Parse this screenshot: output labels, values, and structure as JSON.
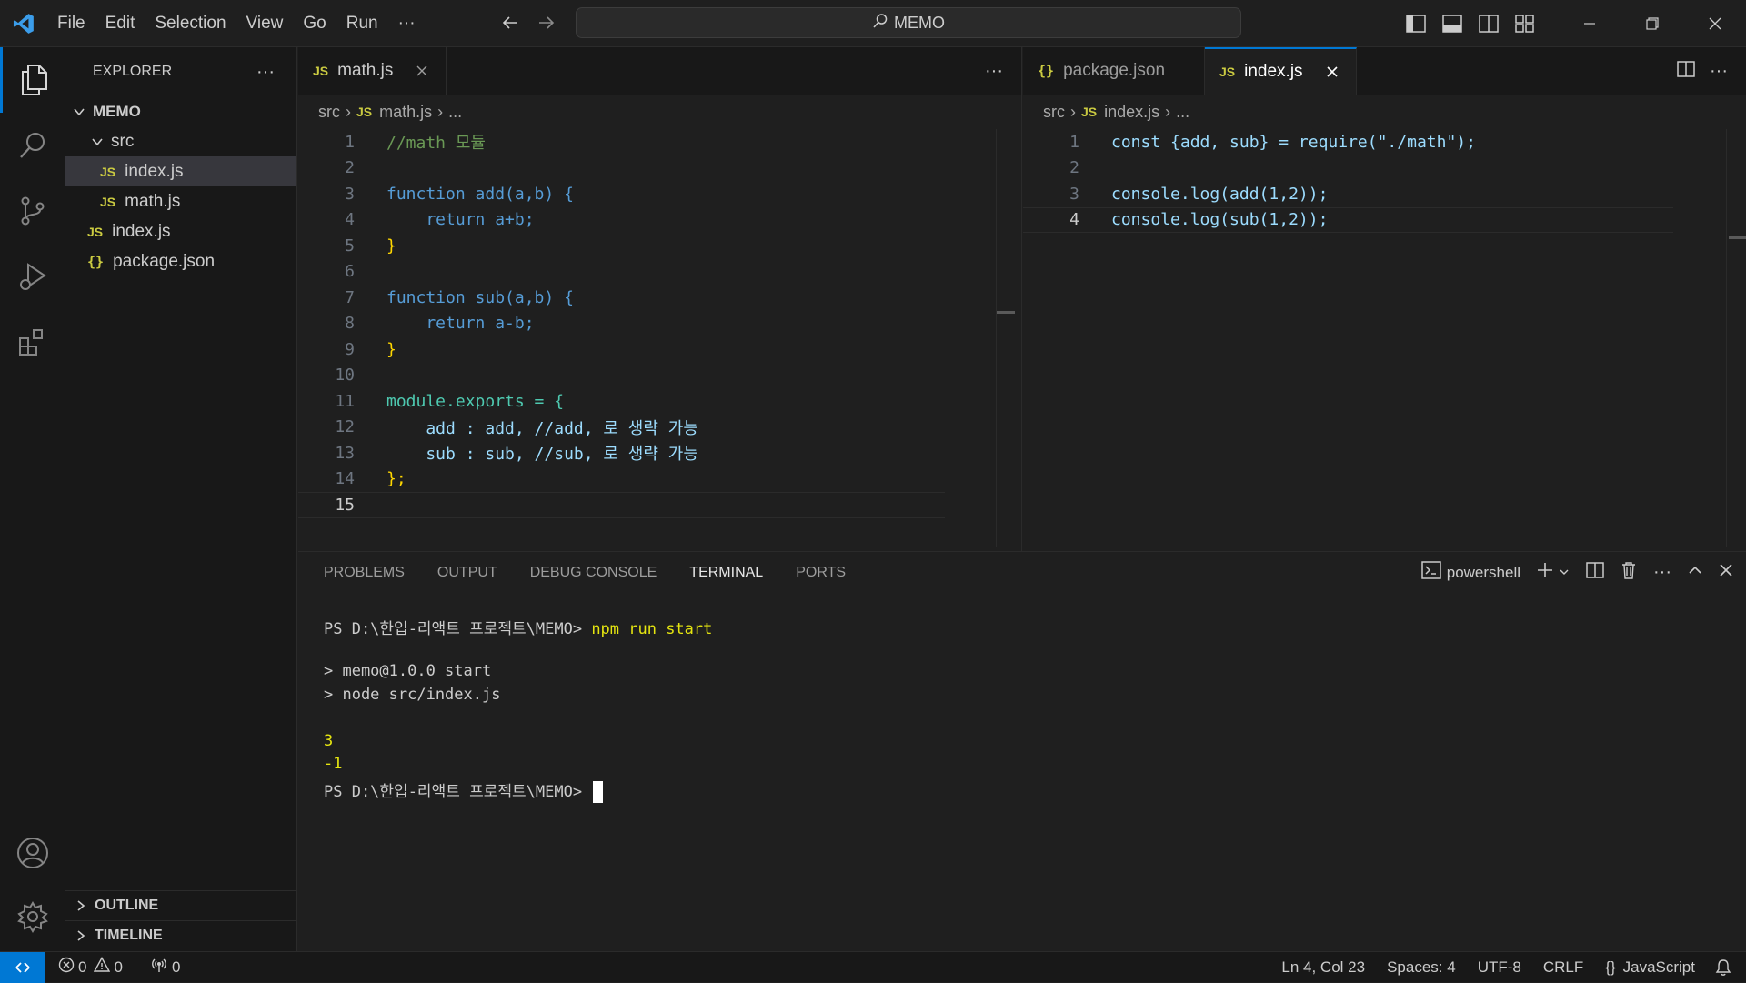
{
  "titlebar": {
    "menus": [
      "File",
      "Edit",
      "Selection",
      "View",
      "Go",
      "Run",
      "···"
    ],
    "search_text": "MEMO"
  },
  "sidebar": {
    "title": "EXPLORER",
    "more": "···",
    "root": "MEMO",
    "tree": [
      {
        "label": "src",
        "type": "folder",
        "depth": 1
      },
      {
        "label": "index.js",
        "type": "js",
        "depth": 2,
        "selected": true
      },
      {
        "label": "math.js",
        "type": "js",
        "depth": 2
      },
      {
        "label": "index.js",
        "type": "js",
        "depth": 1
      },
      {
        "label": "package.json",
        "type": "json",
        "depth": 1
      }
    ],
    "outline": "OUTLINE",
    "timeline": "TIMELINE"
  },
  "left_editor": {
    "tab_label": "math.js",
    "tab_badge": "JS",
    "more": "···",
    "breadcrumb": {
      "folder": "src",
      "badge": "JS",
      "file": "math.js",
      "tail": "..."
    },
    "lines": [
      {
        "n": "1",
        "text": "//math 모듈"
      },
      {
        "n": "2",
        "text": ""
      },
      {
        "n": "3",
        "text": "function add(a,b) {"
      },
      {
        "n": "4",
        "text": "    return a+b;"
      },
      {
        "n": "5",
        "text": "}"
      },
      {
        "n": "6",
        "text": ""
      },
      {
        "n": "7",
        "text": "function sub(a,b) {"
      },
      {
        "n": "8",
        "text": "    return a-b;"
      },
      {
        "n": "9",
        "text": "}"
      },
      {
        "n": "10",
        "text": ""
      },
      {
        "n": "11",
        "text": "module.exports = {"
      },
      {
        "n": "12",
        "text": "    add : add, //add, 로 생략 가능"
      },
      {
        "n": "13",
        "text": "    sub : sub, //sub, 로 생략 가능"
      },
      {
        "n": "14",
        "text": "};"
      },
      {
        "n": "15",
        "text": ""
      }
    ]
  },
  "right_editor": {
    "tabs": [
      {
        "label": "package.json",
        "badge": "{}"
      },
      {
        "label": "index.js",
        "badge": "JS",
        "active": true
      }
    ],
    "more": "···",
    "breadcrumb": {
      "folder": "src",
      "badge": "JS",
      "file": "index.js",
      "tail": "..."
    },
    "lines": [
      {
        "n": "1",
        "text": "const {add, sub} = require(\"./math\");"
      },
      {
        "n": "2",
        "text": ""
      },
      {
        "n": "3",
        "text": "console.log(add(1,2));"
      },
      {
        "n": "4",
        "text": "console.log(sub(1,2));"
      }
    ]
  },
  "panel": {
    "tabs": [
      "PROBLEMS",
      "OUTPUT",
      "DEBUG CONSOLE",
      "TERMINAL",
      "PORTS"
    ],
    "active_tab": "TERMINAL",
    "shell": "powershell",
    "more": "···",
    "terminal": {
      "prompt": "PS D:\\한입-리액트 프로젝트\\MEMO>",
      "command": "npm run start",
      "out1": "> memo@1.0.0 start",
      "out2": "> node src/index.js",
      "result1": "3",
      "result2": "-1",
      "prompt2": "PS D:\\한입-리액트 프로젝트\\MEMO>"
    }
  },
  "status": {
    "errors": "0",
    "warnings": "0",
    "ports": "0",
    "position": "Ln 4, Col 23",
    "spaces": "Spaces: 4",
    "encoding": "UTF-8",
    "eol": "CRLF",
    "language_icon": "{}",
    "language": "JavaScript"
  },
  "colors": {
    "accent": "#0078d4",
    "js_badge": "#cbcb41",
    "terminal_yellow": "#e5e510"
  }
}
